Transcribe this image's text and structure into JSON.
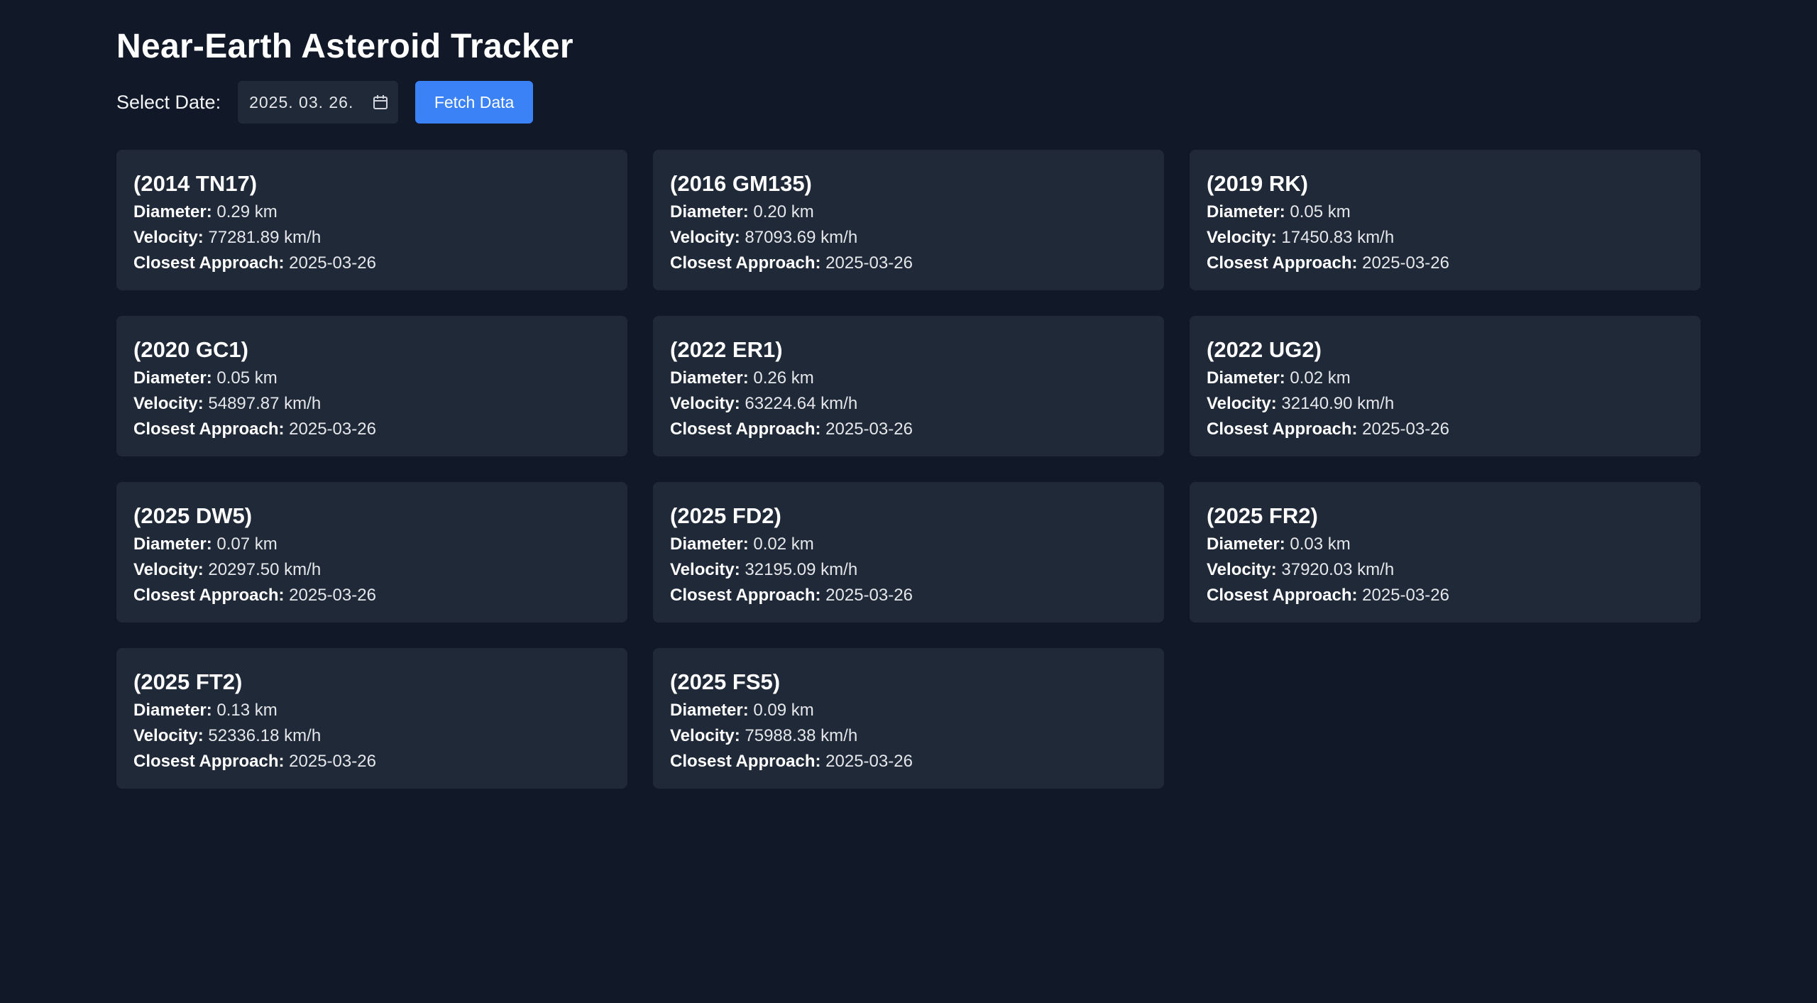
{
  "header": {
    "title": "Near-Earth Asteroid Tracker"
  },
  "controls": {
    "date_label": "Select Date:",
    "date_value": "2025. 03. 26.",
    "fetch_label": "Fetch Data"
  },
  "labels": {
    "diameter": "Diameter:",
    "velocity": "Velocity:",
    "closest": "Closest Approach:"
  },
  "asteroids": [
    {
      "name": "(2014 TN17)",
      "diameter": "0.29 km",
      "velocity": "77281.89 km/h",
      "approach": "2025-03-26"
    },
    {
      "name": "(2016 GM135)",
      "diameter": "0.20 km",
      "velocity": "87093.69 km/h",
      "approach": "2025-03-26"
    },
    {
      "name": "(2019 RK)",
      "diameter": "0.05 km",
      "velocity": "17450.83 km/h",
      "approach": "2025-03-26"
    },
    {
      "name": "(2020 GC1)",
      "diameter": "0.05 km",
      "velocity": "54897.87 km/h",
      "approach": "2025-03-26"
    },
    {
      "name": "(2022 ER1)",
      "diameter": "0.26 km",
      "velocity": "63224.64 km/h",
      "approach": "2025-03-26"
    },
    {
      "name": "(2022 UG2)",
      "diameter": "0.02 km",
      "velocity": "32140.90 km/h",
      "approach": "2025-03-26"
    },
    {
      "name": "(2025 DW5)",
      "diameter": "0.07 km",
      "velocity": "20297.50 km/h",
      "approach": "2025-03-26"
    },
    {
      "name": "(2025 FD2)",
      "diameter": "0.02 km",
      "velocity": "32195.09 km/h",
      "approach": "2025-03-26"
    },
    {
      "name": "(2025 FR2)",
      "diameter": "0.03 km",
      "velocity": "37920.03 km/h",
      "approach": "2025-03-26"
    },
    {
      "name": "(2025 FT2)",
      "diameter": "0.13 km",
      "velocity": "52336.18 km/h",
      "approach": "2025-03-26"
    },
    {
      "name": "(2025 FS5)",
      "diameter": "0.09 km",
      "velocity": "75988.38 km/h",
      "approach": "2025-03-26"
    }
  ],
  "icons": {
    "calendar": "calendar-icon"
  },
  "colors": {
    "background": "#111827",
    "card": "#1f2937",
    "accent": "#3b82f6"
  }
}
